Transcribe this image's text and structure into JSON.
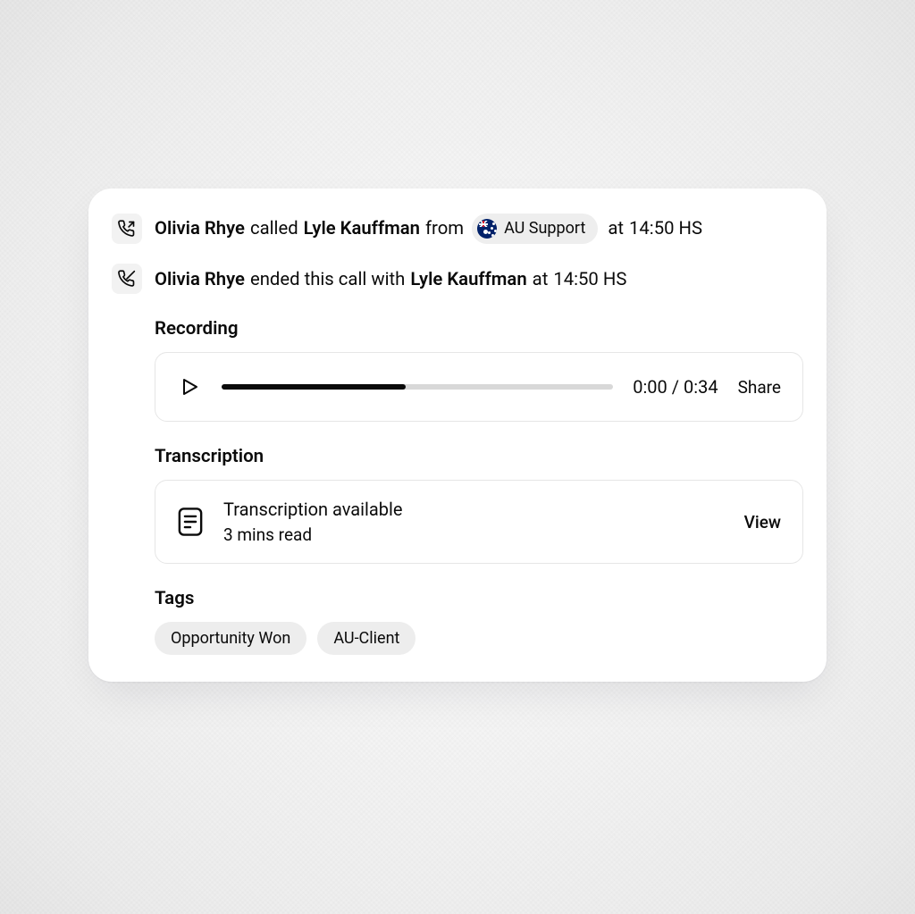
{
  "log": {
    "call": {
      "caller": "Olivia Rhye",
      "verb": "called",
      "callee": "Lyle Kauffman",
      "from_word": "from",
      "source": "AU Support",
      "at_word": "at",
      "time": "14:50 HS"
    },
    "end": {
      "actor": "Olivia Rhye",
      "phrase": "ended this call with",
      "with": "Lyle Kauffman",
      "at_word": "at",
      "time": "14:50 HS"
    }
  },
  "recording": {
    "heading": "Recording",
    "current": "0:00",
    "sep": "/",
    "total": "0:34",
    "share": "Share"
  },
  "transcription": {
    "heading": "Transcription",
    "title": "Transcription available",
    "sub": "3 mins read",
    "view": "View"
  },
  "tags": {
    "heading": "Tags",
    "items": [
      "Opportunity Won",
      "AU-Client"
    ]
  }
}
